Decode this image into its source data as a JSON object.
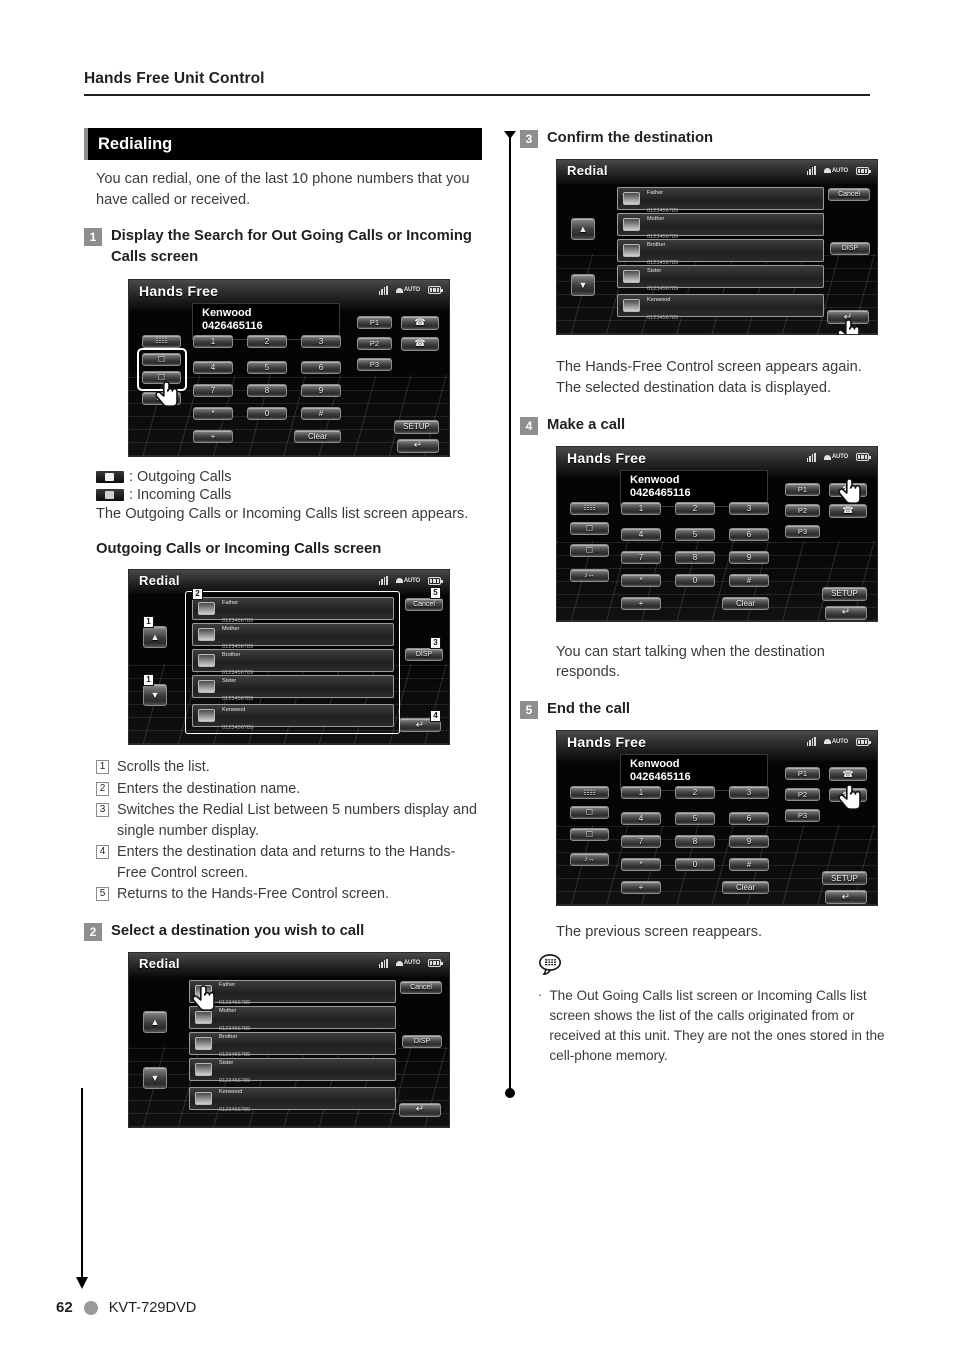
{
  "page": {
    "running_head": "Hands Free Unit Control",
    "page_number": "62",
    "model": "KVT-729DVD"
  },
  "section": {
    "title": "Redialing",
    "intro": "You can redial, one of the last 10 phone numbers that you have called or received."
  },
  "steps": [
    {
      "num": "1",
      "title": "Display the Search for Out Going Calls or Incoming Calls screen"
    },
    {
      "num": "2",
      "title": "Select a destination you wish to call"
    },
    {
      "num": "3",
      "title": "Confirm the destination"
    },
    {
      "num": "4",
      "title": "Make a call"
    },
    {
      "num": "5",
      "title": "End the call"
    }
  ],
  "icon_legend": [
    {
      "icon": "outgoing-calls-icon",
      "label": ": Outgoing Calls"
    },
    {
      "icon": "incoming-calls-icon",
      "label": ": Incoming Calls"
    }
  ],
  "after_step1_text": "The Outgoing Calls or Incoming Calls list screen appears.",
  "subhead_calls_screen": "Outgoing Calls or Incoming Calls screen",
  "legend": [
    {
      "n": "1",
      "text": "Scrolls the list."
    },
    {
      "n": "2",
      "text": "Enters the destination name."
    },
    {
      "n": "3",
      "text": "Switches the Redial List between 5 numbers display and single number display."
    },
    {
      "n": "4",
      "text": "Enters the destination data and returns to the Hands-Free Control screen."
    },
    {
      "n": "5",
      "text": "Returns to the Hands-Free Control screen."
    }
  ],
  "after_step3_text": "The Hands-Free Control screen appears again. The selected destination data is displayed.",
  "after_step4_text": "You can start talking when the destination responds.",
  "after_step5_text": "The previous screen reappears.",
  "note": {
    "icon": "note-bubble-icon",
    "bullet": "·",
    "text": "The Out Going Calls list screen or Incoming Calls list screen shows the list of the calls originated from or received at this unit. They are not the ones stored in the cell-phone memory."
  },
  "handsfree_screen": {
    "title": "Hands Free",
    "display": {
      "name": "Kenwood",
      "number": "0426465116"
    },
    "status": {
      "signal": "signal-icon",
      "auto": "AUTO",
      "battery": "battery-icon"
    },
    "keypad": [
      "1",
      "2",
      "3",
      "4",
      "5",
      "6",
      "7",
      "8",
      "9",
      "*",
      "0",
      "#",
      "+"
    ],
    "clear_label": "Clear",
    "preset_labels": [
      "P1",
      "P2",
      "P3"
    ],
    "setup_label": "SETUP",
    "side_icons": [
      "phonebook-icon",
      "outgoing-calls-icon",
      "incoming-calls-icon",
      "audio-transfer-icon"
    ],
    "call_icons": [
      "answer-call-icon",
      "end-call-icon"
    ],
    "return_icon": "return-arrow-icon"
  },
  "redial_screen": {
    "title": "Redial",
    "cancel_label": "Cancel",
    "disp_label": "DISP",
    "return_icon": "return-arrow-icon",
    "scroll_up_icon": "scroll-up-icon",
    "scroll_down_icon": "scroll-down-icon",
    "entries": [
      {
        "name": "Father",
        "number": "0123456789"
      },
      {
        "name": "Mother",
        "number": "0123456789"
      },
      {
        "name": "Brother",
        "number": "0123456789"
      },
      {
        "name": "Sister",
        "number": "0123456789"
      },
      {
        "name": "Kenwood",
        "number": "0123456789"
      }
    ],
    "callouts": [
      "1",
      "2",
      "3",
      "4",
      "5"
    ]
  },
  "colors": {
    "section_bar": "#000000",
    "section_bar_accent": "#8e8e8e",
    "step_badge": "#8e8e8e",
    "body_text": "#3b3b3b",
    "screen_bg": "#050505"
  }
}
